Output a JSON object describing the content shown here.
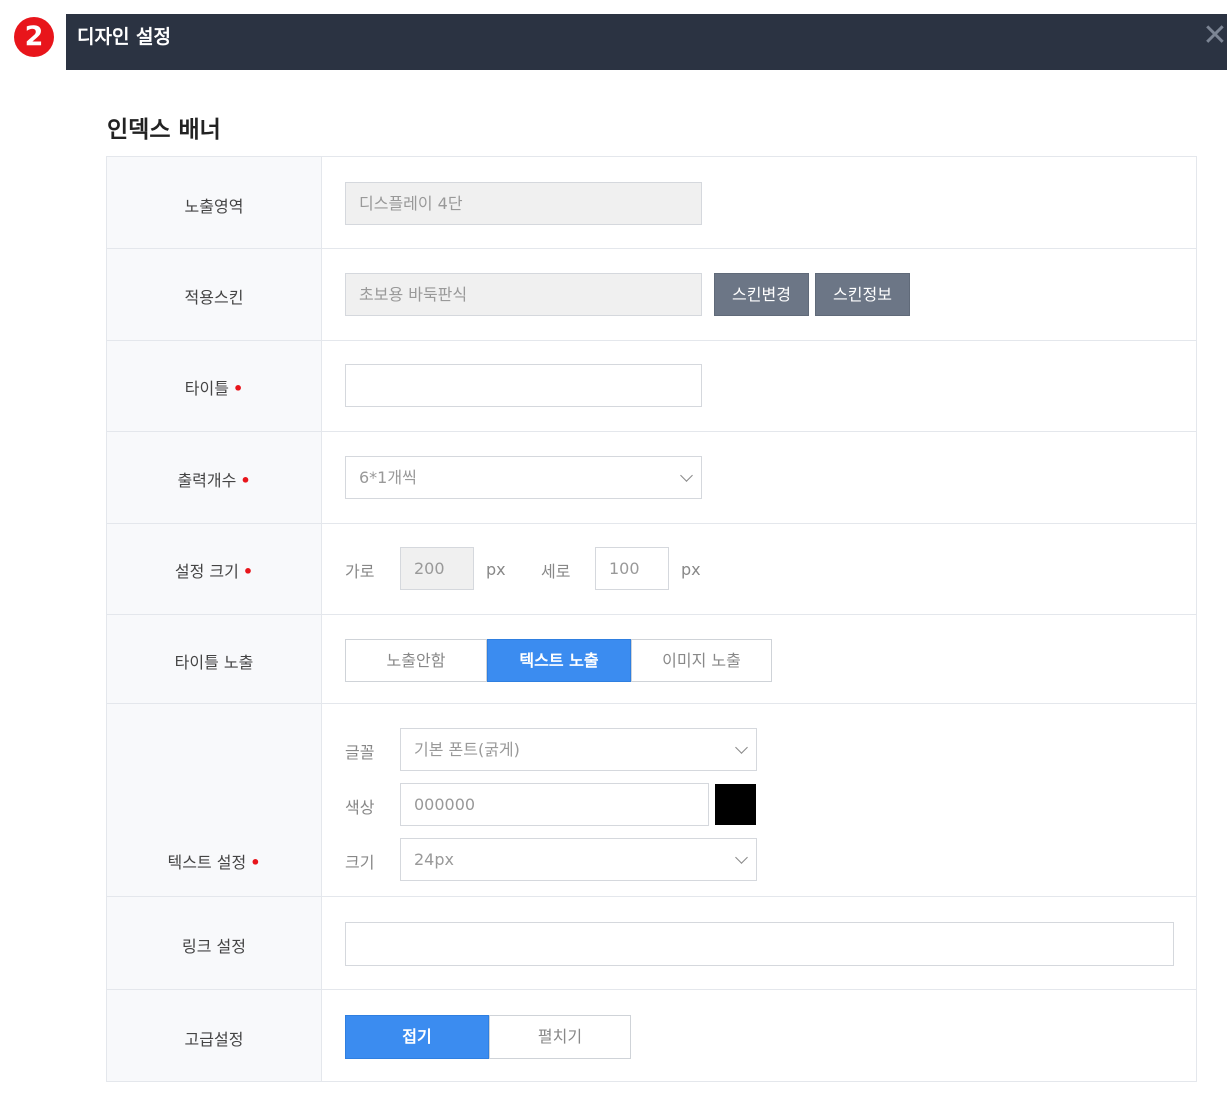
{
  "step_number": "2",
  "dialog": {
    "title": "디자인 설정",
    "close_glyph": "✕"
  },
  "section_title": "인덱스 배너",
  "rows": {
    "display_area": {
      "label": "노출영역",
      "value": "디스플레이 4단"
    },
    "applied_skin": {
      "label": "적용스킨",
      "value": "초보용 바둑판식",
      "change_button": "스킨변경",
      "info_button": "스킨정보"
    },
    "title": {
      "label": "타이틀",
      "value": ""
    },
    "output_count": {
      "label": "출력개수",
      "value": "6*1개씩"
    },
    "size": {
      "label": "설정 크기",
      "width_label": "가로",
      "width_value": "200",
      "width_unit": "px",
      "height_label": "세로",
      "height_value": "100",
      "height_unit": "px"
    },
    "title_display": {
      "label": "타이틀 노출",
      "options": [
        "노출안함",
        "텍스트 노출",
        "이미지 노출"
      ],
      "selected": "텍스트 노출"
    },
    "text_settings": {
      "label": "텍스트 설정",
      "font_label": "글꼴",
      "font_value": "기본 폰트(굵게)",
      "color_label": "색상",
      "color_value": "000000",
      "size_label": "크기",
      "size_value": "24px"
    },
    "link": {
      "label": "링크 설정",
      "value": ""
    },
    "advanced": {
      "label": "고급설정",
      "options": [
        "접기",
        "펼치기"
      ],
      "selected": "접기"
    }
  },
  "required_mark": "•",
  "colors": {
    "header_bg": "#2b3342",
    "accent": "#3b8cf0",
    "badge": "#e8151b",
    "gray_button": "#6c7686",
    "swatch": "#000000"
  }
}
